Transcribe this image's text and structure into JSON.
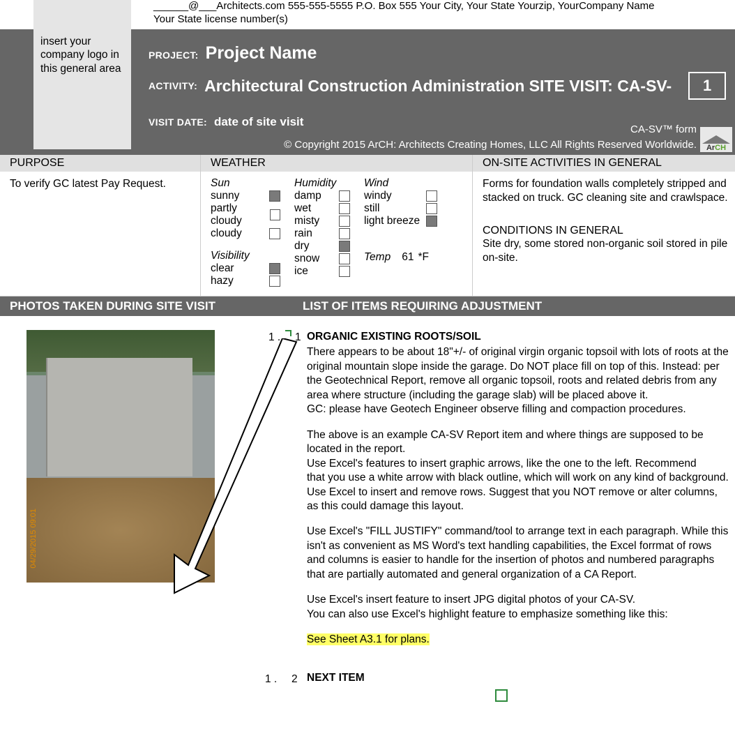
{
  "contact": "______@___Architects.com 555-555-5555 P.O. Box 555 Your City, Your State  Yourzip, YourCompany Name",
  "license": "Your State license number(s)",
  "logo_placeholder": "insert your company logo in this general area",
  "header": {
    "project_label": "PROJECT:",
    "project_value": "Project Name",
    "activity_label": "ACTIVITY:",
    "activity_value": "Architectural Construction Administration SITE VISIT:  CA-SV-",
    "visit_number": "1",
    "visit_date_label": "VISIT DATE:",
    "visit_date_value": "date of site visit",
    "form_meta": "CA-SV™ form",
    "copyright": "© Copyright 2015 ArCH: Architects Creating Homes, LLC All Rights Reserved Worldwide.",
    "brand": "ArCH"
  },
  "purpose": {
    "header": "PURPOSE",
    "text": "To verify GC latest Pay Request."
  },
  "weather": {
    "header": "WEATHER",
    "sun": {
      "label": "Sun",
      "options": [
        {
          "name": "sunny",
          "checked": true
        },
        {
          "name": "partly cloudy",
          "checked": false
        },
        {
          "name": "cloudy",
          "checked": false
        }
      ]
    },
    "visibility": {
      "label": "Visibility",
      "options": [
        {
          "name": "clear",
          "checked": true
        },
        {
          "name": "hazy",
          "checked": false
        }
      ]
    },
    "humidity": {
      "label": "Humidity",
      "options": [
        {
          "name": "damp",
          "checked": false
        },
        {
          "name": "wet",
          "checked": false
        },
        {
          "name": "misty",
          "checked": false
        },
        {
          "name": "rain",
          "checked": false
        },
        {
          "name": "dry",
          "checked": true
        },
        {
          "name": "snow",
          "checked": false
        },
        {
          "name": "ice",
          "checked": false
        }
      ]
    },
    "wind": {
      "label": "Wind",
      "options": [
        {
          "name": "windy",
          "checked": false
        },
        {
          "name": "still",
          "checked": false
        },
        {
          "name": "light breeze",
          "checked": true
        }
      ]
    },
    "temp": {
      "label": "Temp",
      "value": "61",
      "unit": "*F"
    }
  },
  "onsite": {
    "header": "ON-SITE ACTIVITIES IN GENERAL",
    "text": "Forms for foundation walls completely stripped and stacked on truck. GC cleaning site and crawlspace.",
    "cond_header": "CONDITIONS IN GENERAL",
    "cond_text": "Site dry, some stored non-organic soil stored in pile on-site."
  },
  "section_bar": {
    "left": "PHOTOS TAKEN DURING SITE VISIT",
    "right": "LIST OF ITEMS REQUIRING ADJUSTMENT"
  },
  "items": [
    {
      "num_left": "1 .",
      "num_right": "1",
      "title": "ORGANIC EXISTING ROOTS/SOIL",
      "paras": [
        "There appears to be about 18\"+/- of original virgin organic topsoil with lots of roots at the original mountain slope inside the garage.  Do NOT place fill on top of this.  Instead: per the Geotechnical Report, remove all organic topsoil, roots and related debris from any area where structure (including the garage slab) will be placed above it.\nGC: please have Geotech Engineer observe filling and compaction procedures.",
        "The above is an example CA-SV Report item and where things are supposed to be located in the report.\nUse Excel's features to insert graphic arrows, like the one to the left.  Recommend\n that you use a white arrow with black outline, which will work on any kind of background.\nUse Excel to insert and remove rows.  Suggest that you NOT remove or alter columns, as this could damage this layout.",
        "Use Excel's \"FILL JUSTIFY\" command/tool to arrange text in each paragraph. While this isn't as convenient as MS Word's text handling capabilities, the Excel forrmat of rows and columns is easier to handle for the insertion of photos and numbered paragraphs that are partially automated and general organization of a CA Report.",
        "Use Excel's insert feature to insert JPG digital photos of your CA-SV.\nYou can also use Excel's highlight feature to emphasize something like this:"
      ],
      "highlight": "See Sheet A3.1 for plans."
    },
    {
      "num_left": "1 .",
      "num_right": "2",
      "title": "NEXT ITEM"
    }
  ],
  "photo_date": "04/29/2015 09:01"
}
